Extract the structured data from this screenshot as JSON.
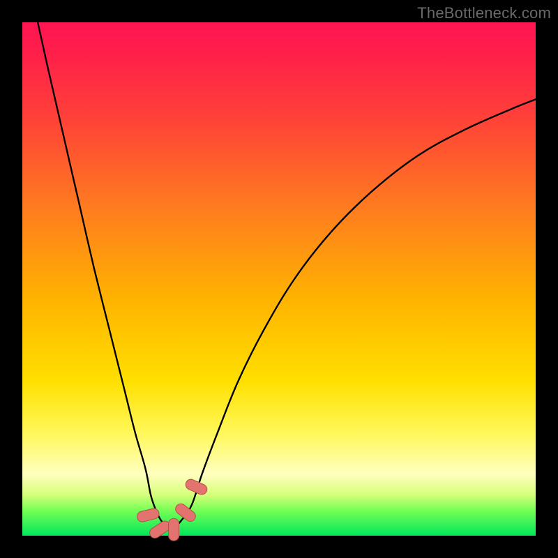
{
  "watermark": "TheBottleneck.com",
  "chart_data": {
    "type": "line",
    "title": "",
    "xlabel": "",
    "ylabel": "",
    "xlim": [
      0,
      100
    ],
    "ylim": [
      0,
      100
    ],
    "grid": false,
    "legend": false,
    "series": [
      {
        "name": "bottleneck-curve",
        "x": [
          3,
          5,
          8,
          11,
          14,
          17,
          20,
          22,
          24,
          25,
          26,
          27,
          28,
          29,
          30,
          31,
          33,
          35,
          38,
          42,
          47,
          53,
          60,
          68,
          77,
          86,
          95,
          100
        ],
        "y": [
          100,
          91,
          78,
          65,
          52,
          40,
          28,
          20,
          13,
          8,
          5,
          3,
          2,
          1.5,
          2,
          3,
          6,
          12,
          20,
          30,
          40,
          50,
          59,
          67,
          74,
          79,
          83,
          85
        ]
      }
    ],
    "markers": [
      {
        "name": "flat-left",
        "x": 24.5,
        "y": 4
      },
      {
        "name": "flat-mid-l",
        "x": 26.8,
        "y": 1.2
      },
      {
        "name": "flat-mid-r",
        "x": 29.5,
        "y": 1.2
      },
      {
        "name": "flat-right",
        "x": 31.8,
        "y": 4.5
      },
      {
        "name": "flat-far-r",
        "x": 33.9,
        "y": 9.5
      }
    ],
    "colors": {
      "curve": "#000000",
      "marker_fill": "#e2736f",
      "marker_stroke": "#b84f4b"
    }
  }
}
